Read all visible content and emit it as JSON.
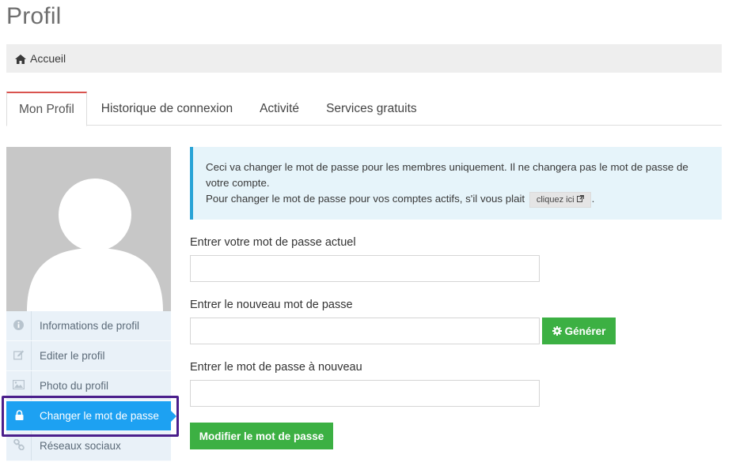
{
  "page": {
    "title": "Profil"
  },
  "breadcrumb": {
    "home_label": "Accueil"
  },
  "tabs": [
    {
      "label": "Mon Profil",
      "active": true
    },
    {
      "label": "Historique de connexion",
      "active": false
    },
    {
      "label": "Activité",
      "active": false
    },
    {
      "label": "Services gratuits",
      "active": false
    }
  ],
  "sidebar": {
    "items": [
      {
        "label": "Informations de profil",
        "icon": "info-icon"
      },
      {
        "label": "Editer le profil",
        "icon": "edit-icon"
      },
      {
        "label": "Photo du profil",
        "icon": "picture-icon"
      },
      {
        "label": "Changer le mot de passe",
        "icon": "lock-icon",
        "active": true
      },
      {
        "label": "Réseaux sociaux",
        "icon": "link-icon"
      }
    ]
  },
  "alert": {
    "line1": "Ceci va changer le mot de passe pour les membres uniquement. Il ne changera pas le mot de passe de votre compte.",
    "line2": "Pour changer le mot de passe pour vos comptes actifs, s'il vous plait",
    "link_label": "cliquez ici",
    "after_link": "."
  },
  "form": {
    "current_label": "Entrer votre mot de passe actuel",
    "current_value": "",
    "new_label": "Entrer le nouveau mot de passe",
    "new_value": "",
    "generate_label": "Générer",
    "confirm_label": "Entrer le mot de passe à nouveau",
    "confirm_value": "",
    "submit_label": "Modifier le mot de passe"
  },
  "colors": {
    "active_tab_border": "#d9534f",
    "sidebar_active": "#1da1f2",
    "button_green": "#3cb043",
    "alert_border": "#29a3d6"
  }
}
